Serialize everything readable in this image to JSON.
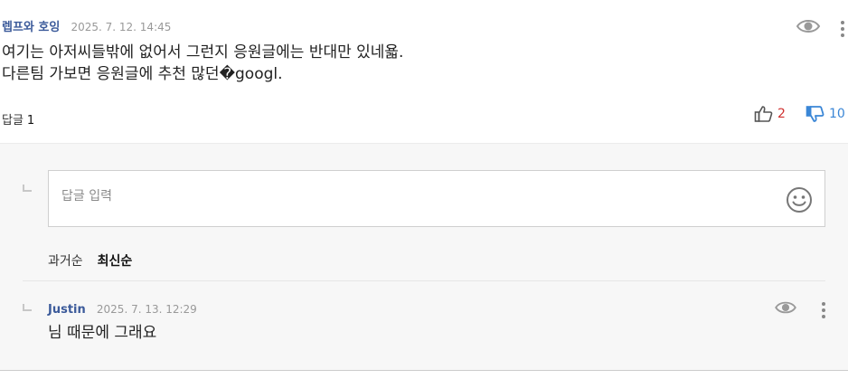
{
  "comment": {
    "author": "렙프와 호잉",
    "date": "2025. 7. 12. 14:45",
    "lines": [
      "여기는 아저씨들밖에 없어서 그런지 응원글에는 반대만 있네욟.",
      "다른팀 가보면 응원글에 추천 많던�googl."
    ],
    "reply_label": "답글",
    "reply_count": "1",
    "like_count": "2",
    "dislike_count": "10"
  },
  "reply_form": {
    "placeholder": "답글 입력"
  },
  "sort": {
    "oldest": "과거순",
    "newest": "최신순"
  },
  "replies": [
    {
      "author": "Justin",
      "date": "2025. 7. 13. 12:29",
      "text": "님 때문에 그래요"
    }
  ],
  "colors": {
    "author": "#3b5a9a",
    "like": "#d0302f",
    "dislike": "#3a86d6",
    "reply_bg": "#f7f7f7"
  },
  "icons": [
    "eye-icon",
    "more-vertical-icon",
    "thumbs-up-icon",
    "thumbs-down-icon",
    "smiley-icon",
    "reply-indent-icon"
  ]
}
